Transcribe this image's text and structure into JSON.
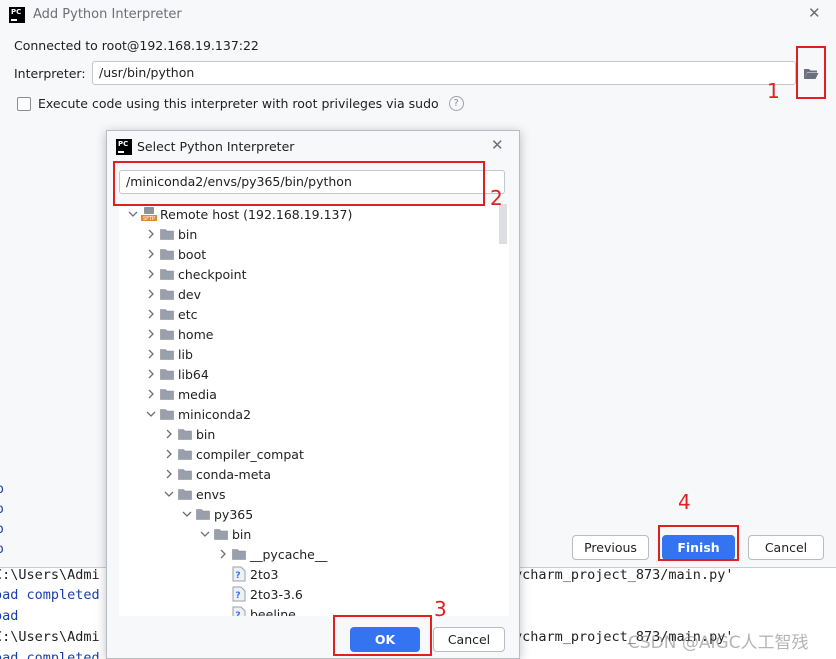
{
  "main_dialog": {
    "title": "Add Python Interpreter",
    "connected_text": "Connected to root@192.168.19.137:22",
    "interpreter_label": "Interpreter:",
    "interpreter_value": "/usr/bin/python",
    "sudo_checkbox_label": "Execute code using this interpreter with root privileges via sudo",
    "sudo_checked": false,
    "buttons": {
      "previous": "Previous",
      "finish": "Finish",
      "cancel": "Cancel"
    }
  },
  "select_dialog": {
    "title": "Select Python Interpreter",
    "path_value": "/miniconda2/envs/py365/bin/python",
    "tree": [
      {
        "label": "Remote host (192.168.19.137)",
        "depth": 0,
        "state": "expanded",
        "icon": "sftp-host-icon"
      },
      {
        "label": "bin",
        "depth": 1,
        "state": "collapsed",
        "icon": "folder-icon"
      },
      {
        "label": "boot",
        "depth": 1,
        "state": "collapsed",
        "icon": "folder-icon"
      },
      {
        "label": "checkpoint",
        "depth": 1,
        "state": "collapsed",
        "icon": "folder-icon"
      },
      {
        "label": "dev",
        "depth": 1,
        "state": "collapsed",
        "icon": "folder-icon"
      },
      {
        "label": "etc",
        "depth": 1,
        "state": "collapsed",
        "icon": "folder-icon"
      },
      {
        "label": "home",
        "depth": 1,
        "state": "collapsed",
        "icon": "folder-icon"
      },
      {
        "label": "lib",
        "depth": 1,
        "state": "collapsed",
        "icon": "folder-icon"
      },
      {
        "label": "lib64",
        "depth": 1,
        "state": "collapsed",
        "icon": "folder-icon"
      },
      {
        "label": "media",
        "depth": 1,
        "state": "collapsed",
        "icon": "folder-icon"
      },
      {
        "label": "miniconda2",
        "depth": 1,
        "state": "expanded",
        "icon": "folder-icon"
      },
      {
        "label": "bin",
        "depth": 2,
        "state": "collapsed",
        "icon": "folder-icon"
      },
      {
        "label": "compiler_compat",
        "depth": 2,
        "state": "collapsed",
        "icon": "folder-icon"
      },
      {
        "label": "conda-meta",
        "depth": 2,
        "state": "collapsed",
        "icon": "folder-icon"
      },
      {
        "label": "envs",
        "depth": 2,
        "state": "expanded",
        "icon": "folder-icon"
      },
      {
        "label": "py365",
        "depth": 3,
        "state": "expanded",
        "icon": "folder-icon"
      },
      {
        "label": "bin",
        "depth": 4,
        "state": "expanded",
        "icon": "folder-icon"
      },
      {
        "label": "__pycache__",
        "depth": 5,
        "state": "collapsed",
        "icon": "folder-icon"
      },
      {
        "label": "2to3",
        "depth": 5,
        "state": "leaf",
        "icon": "unknown-file-icon"
      },
      {
        "label": "2to3-3.6",
        "depth": 5,
        "state": "leaf",
        "icon": "unknown-file-icon"
      },
      {
        "label": "beeline",
        "depth": 5,
        "state": "leaf",
        "icon": "unknown-file-icon"
      }
    ],
    "buttons": {
      "ok": "OK",
      "cancel": "Cancel"
    }
  },
  "annotations": [
    "1",
    "2",
    "3",
    "4"
  ],
  "console": {
    "line1": "C:\\Users\\Admi",
    "line1_right": "ycharm_project_873/main.py'",
    "line2": "oad completed",
    "line3": "oad",
    "line4": "C:\\Users\\Admi",
    "line4_right": "ycharm_project_873/main.py'",
    "line5": "oad completed",
    "left_fragments": [
      "b",
      "o",
      "o",
      "o"
    ]
  },
  "watermark": "CSDN @AIGC人工智残",
  "colors": {
    "accent": "#3574f0",
    "annotation_red": "#e02020",
    "dialog_bg": "#f7f8fa",
    "console_blue": "#1a3ea8"
  }
}
